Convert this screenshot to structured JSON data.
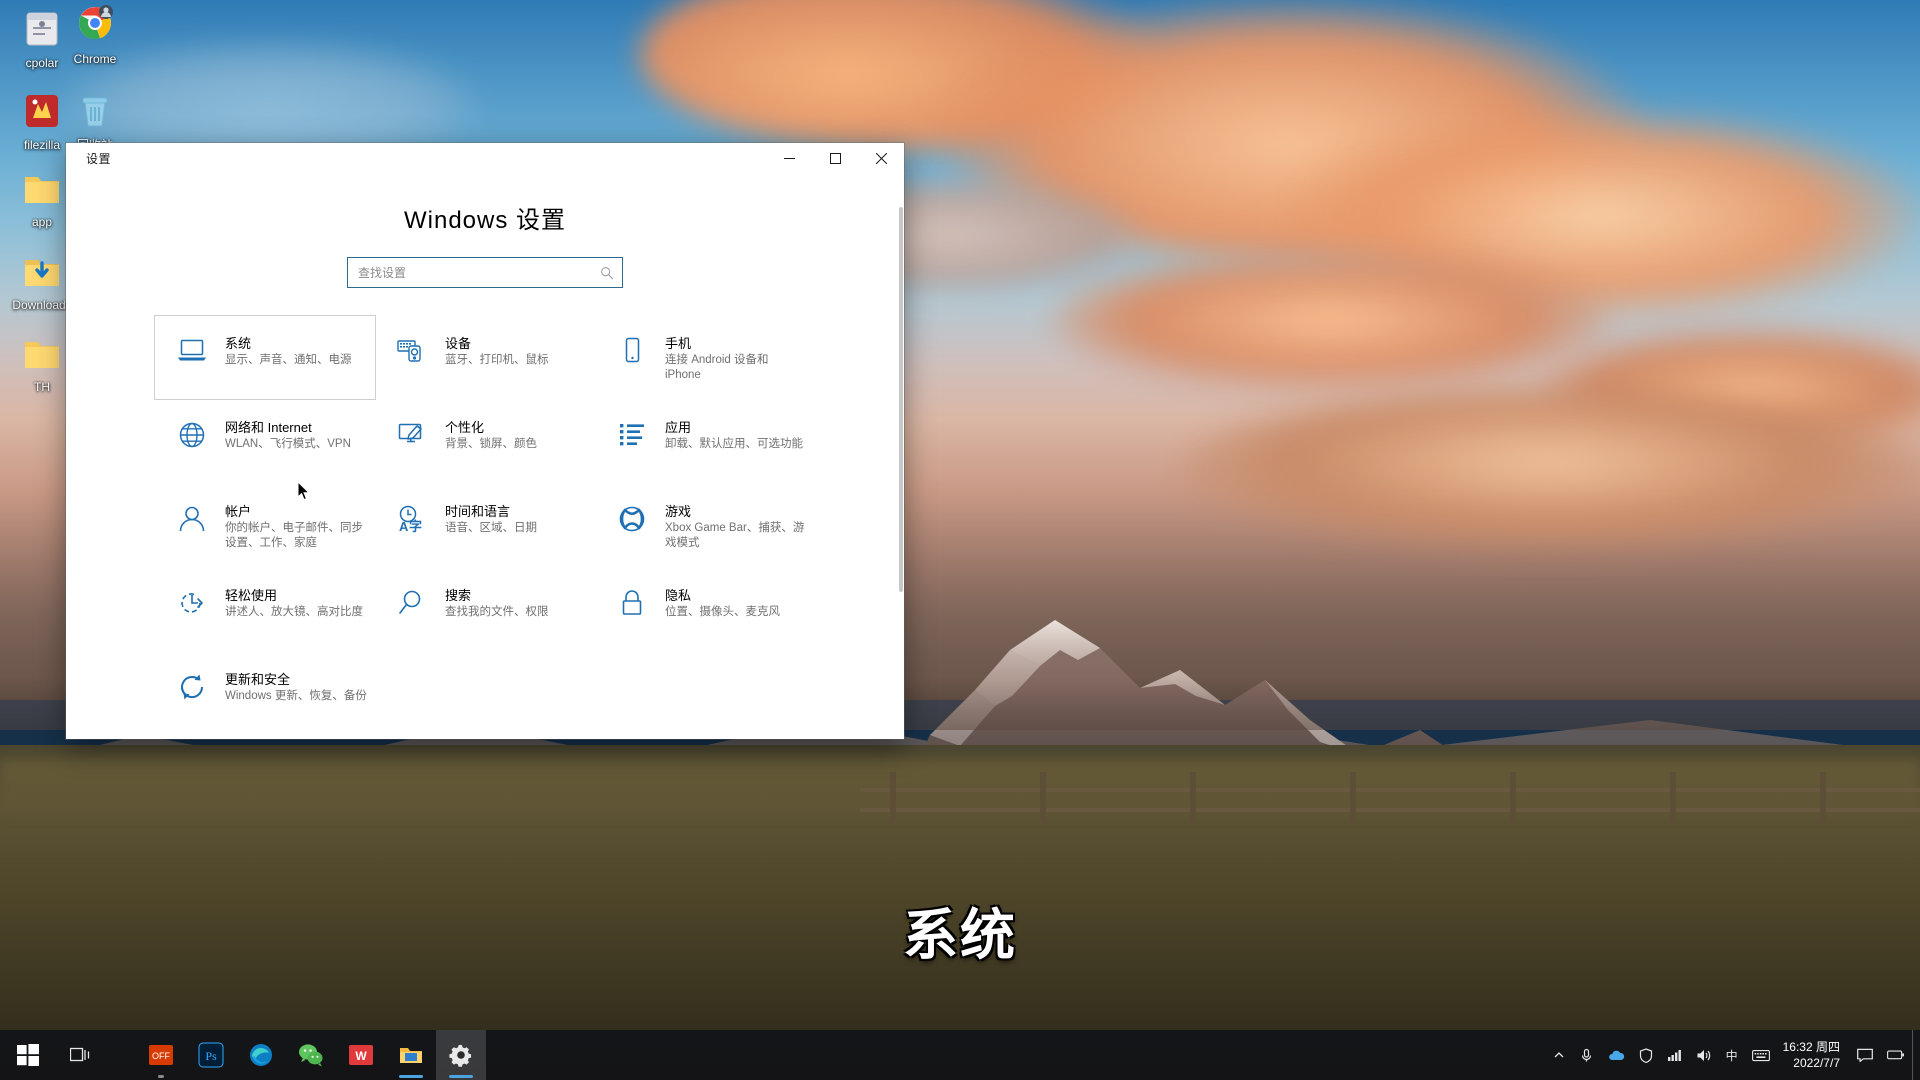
{
  "desktop": {
    "icons": [
      {
        "label": "cpolar",
        "icon": "cpolar-app-icon"
      },
      {
        "label": "Chrome",
        "icon": "chrome-icon"
      },
      {
        "label": "filezilla",
        "icon": "filezilla-icon"
      },
      {
        "label": "回收站",
        "icon": "recycle-bin-icon"
      },
      {
        "label": "app",
        "icon": "folder-icon"
      },
      {
        "label": "Downloads",
        "icon": "downloads-folder-icon"
      },
      {
        "label": "TH",
        "icon": "folder-icon"
      }
    ]
  },
  "window": {
    "title": "设置",
    "controls": {
      "minimize": "─",
      "maximize": "☐",
      "close": "✕"
    }
  },
  "settings": {
    "heading": "Windows 设置",
    "search": {
      "value": "",
      "placeholder": "查找设置",
      "icon": "search-icon"
    },
    "tiles": [
      {
        "title": "系统",
        "subtitle": "显示、声音、通知、电源",
        "icon": "laptop-icon",
        "hovered": true
      },
      {
        "title": "设备",
        "subtitle": "蓝牙、打印机、鼠标",
        "icon": "devices-icon",
        "hovered": false
      },
      {
        "title": "手机",
        "subtitle": "连接 Android 设备和 iPhone",
        "icon": "phone-icon",
        "hovered": false
      },
      {
        "title": "网络和 Internet",
        "subtitle": "WLAN、飞行模式、VPN",
        "icon": "globe-icon",
        "hovered": false
      },
      {
        "title": "个性化",
        "subtitle": "背景、锁屏、颜色",
        "icon": "personalization-icon",
        "hovered": false
      },
      {
        "title": "应用",
        "subtitle": "卸载、默认应用、可选功能",
        "icon": "apps-list-icon",
        "hovered": false
      },
      {
        "title": "帐户",
        "subtitle": "你的帐户、电子邮件、同步设置、工作、家庭",
        "icon": "user-icon",
        "hovered": false
      },
      {
        "title": "时间和语言",
        "subtitle": "语音、区域、日期",
        "icon": "time-language-icon",
        "hovered": false
      },
      {
        "title": "游戏",
        "subtitle": "Xbox Game Bar、捕获、游戏模式",
        "icon": "xbox-icon",
        "hovered": false
      },
      {
        "title": "轻松使用",
        "subtitle": "讲述人、放大镜、高对比度",
        "icon": "ease-of-access-icon",
        "hovered": false
      },
      {
        "title": "搜索",
        "subtitle": "查找我的文件、权限",
        "icon": "magnifier-icon",
        "hovered": false
      },
      {
        "title": "隐私",
        "subtitle": "位置、摄像头、麦克风",
        "icon": "lock-icon",
        "hovered": false
      },
      {
        "title": "更新和安全",
        "subtitle": "Windows 更新、恢复、备份",
        "icon": "update-security-icon",
        "hovered": false
      }
    ]
  },
  "caption": {
    "text": "系统"
  },
  "taskbar": {
    "start": {
      "icon": "windows-start-icon"
    },
    "task_view": {
      "icon": "task-view-icon"
    },
    "pinned": [
      {
        "name": "office-icon",
        "label": "OFF"
      },
      {
        "name": "photoshop-icon",
        "label": "Ps"
      },
      {
        "name": "edge-icon",
        "label": ""
      },
      {
        "name": "wechat-icon",
        "label": ""
      },
      {
        "name": "wps-icon",
        "label": "W"
      },
      {
        "name": "explorer-icon",
        "label": ""
      },
      {
        "name": "settings-gear-icon",
        "label": ""
      }
    ],
    "tray": {
      "show_hidden": "∧",
      "items": [
        {
          "name": "microphone-icon",
          "glyph": "Ἲ4"
        },
        {
          "name": "onedrive-icon",
          "glyph": "☁"
        },
        {
          "name": "shield-icon",
          "glyph": "⛨"
        },
        {
          "name": "network-icon",
          "glyph": "὏6"
        },
        {
          "name": "volume-icon",
          "glyph": "ὐA"
        }
      ],
      "ime": "中",
      "keyboard": "⌨",
      "clock": {
        "time": "16:32 周四",
        "date": "2022/7/7"
      },
      "notifications": {
        "name": "action-center-icon"
      },
      "show_desktop": {
        "name": "show-desktop-button"
      }
    }
  },
  "colors": {
    "accent": "#0078d4",
    "icon_blue": "#0f6cbd",
    "search_border": "#2c6b8f",
    "subtitle": "#707070",
    "taskbar_bg": "#121318"
  }
}
